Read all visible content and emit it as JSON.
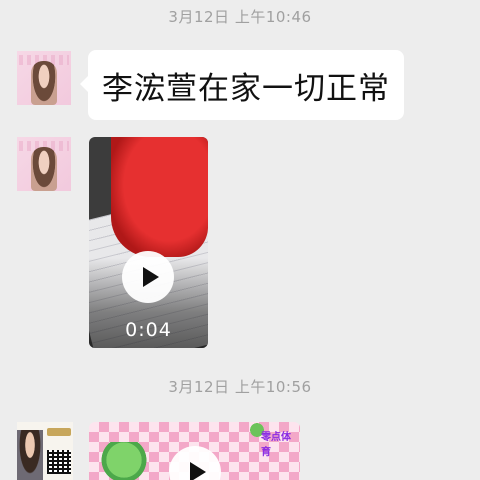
{
  "messages": [
    {
      "type": "timestamp",
      "text": "3月12日 上午10:46"
    },
    {
      "type": "text",
      "sender_avatar": "avatar-woman",
      "text": "李浤萱在家一切正常"
    },
    {
      "type": "video",
      "sender_avatar": "avatar-woman",
      "duration": "0:04",
      "icon": "play-icon"
    },
    {
      "type": "timestamp",
      "text": "3月12日 上午10:56"
    },
    {
      "type": "video",
      "sender_avatar": "avatar-school",
      "icon": "play-icon",
      "brand_text": "零点体育"
    }
  ],
  "colors": {
    "background": "#ededed",
    "bubble": "#ffffff",
    "timestamp": "#a0a0a0"
  }
}
